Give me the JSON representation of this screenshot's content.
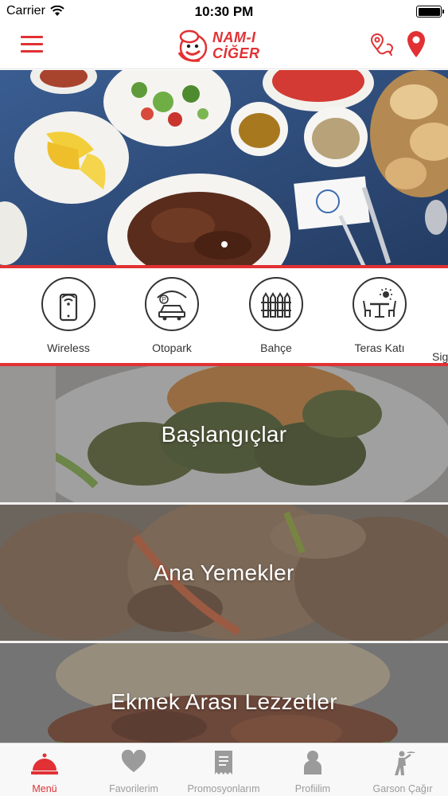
{
  "status_bar": {
    "carrier": "Carrier",
    "time": "10:30 PM",
    "battery_level_percent": 100
  },
  "header": {
    "menu_icon": "hamburger-menu-icon",
    "brand_line1": "NAM-I",
    "brand_line2": "CİĞER",
    "route_icon": "route-location-icon",
    "location_icon": "map-pin-icon"
  },
  "hero": {
    "slide_count": 1,
    "active_slide": 1
  },
  "amenities": [
    {
      "label": "Wireless",
      "icon": "wireless-phone-icon"
    },
    {
      "label": "Otopark",
      "icon": "parking-car-icon"
    },
    {
      "label": "Bahçe",
      "icon": "garden-fence-icon"
    },
    {
      "label": "Teras Katı",
      "icon": "terrace-table-icon"
    },
    {
      "label": "Sig",
      "icon": "partial-icon"
    }
  ],
  "categories": [
    {
      "title": "Başlangıçlar"
    },
    {
      "title": "Ana Yemekler"
    },
    {
      "title": "Ekmek Arası Lezzetler"
    }
  ],
  "tabbar": {
    "tabs": [
      {
        "label": "Menü",
        "icon": "cloche-icon",
        "active": true
      },
      {
        "label": "Favorilerim",
        "icon": "heart-icon",
        "active": false
      },
      {
        "label": "Promosyonlarım",
        "icon": "receipt-icon",
        "active": false
      },
      {
        "label": "Profiilim",
        "icon": "person-icon",
        "active": false
      },
      {
        "label": "Garson Çağır",
        "icon": "waiter-icon",
        "active": false
      }
    ]
  },
  "colors": {
    "brand_red": "#e13134",
    "tab_inactive": "#9b9b9b"
  }
}
